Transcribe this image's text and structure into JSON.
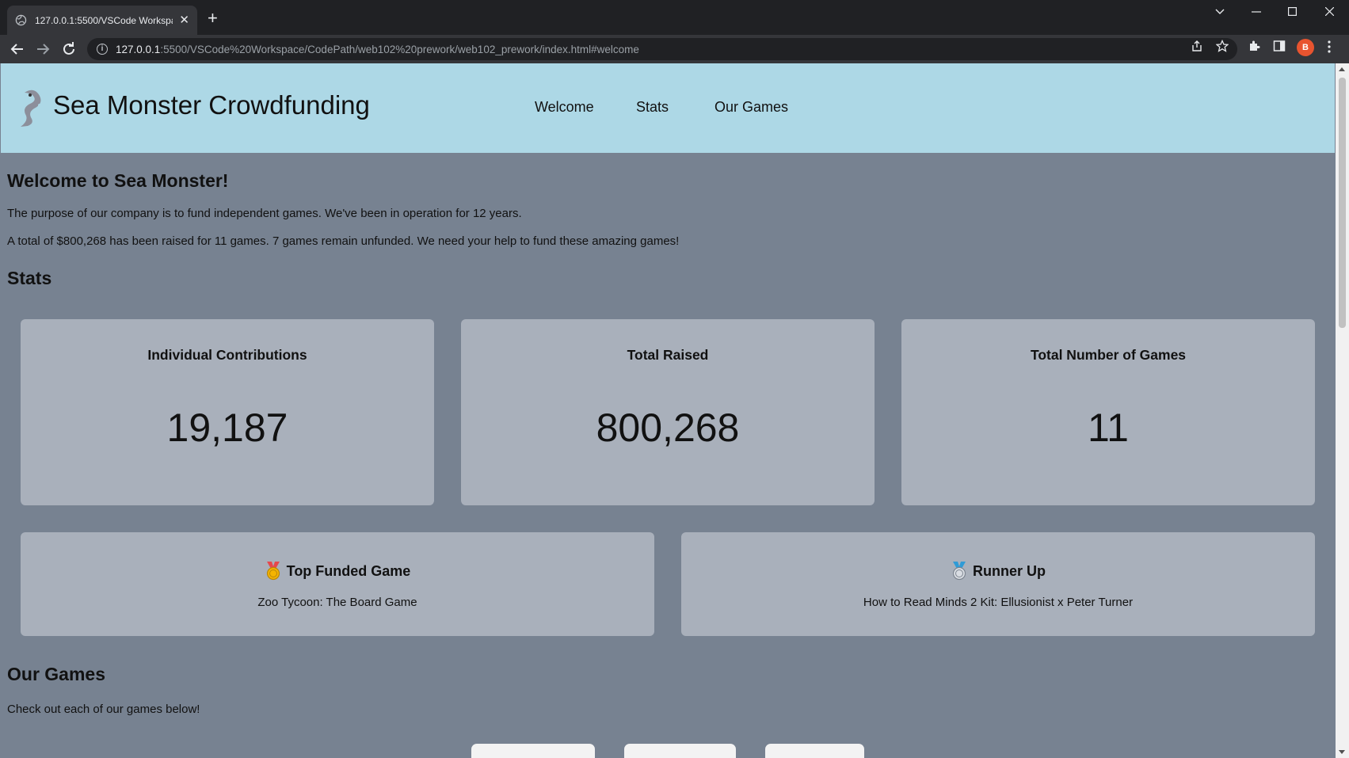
{
  "browser": {
    "tab_title": "127.0.0.1:5500/VSCode Workspac",
    "url_host": "127.0.0.1",
    "url_path": ":5500/VSCode%20Workspace/CodePath/web102%20prework/web102_prework/index.html#welcome",
    "profile_initial": "B",
    "new_tab_glyph": "+",
    "close_glyph": "✕"
  },
  "header": {
    "title": "Sea Monster Crowdfunding",
    "nav": [
      "Welcome",
      "Stats",
      "Our Games"
    ]
  },
  "welcome": {
    "heading": "Welcome to Sea Monster!",
    "intro": "The purpose of our company is to fund independent games. We've been in operation for 12 years.",
    "summary": "A total of $800,268 has been raised for 11 games. 7 games remain unfunded. We need your help to fund these amazing games!"
  },
  "stats": {
    "heading": "Stats",
    "cards": [
      {
        "label": "Individual Contributions",
        "value": "19,187"
      },
      {
        "label": "Total Raised",
        "value": "800,268"
      },
      {
        "label": "Total Number of Games",
        "value": "11"
      }
    ],
    "top_funded": {
      "label": "Top Funded Game",
      "name": "Zoo Tycoon: The Board Game",
      "icon": "gold-medal-icon"
    },
    "runner_up": {
      "label": "Runner Up",
      "name": "How to Read Minds 2 Kit: Ellusionist x Peter Turner",
      "icon": "silver-medal-icon"
    }
  },
  "games": {
    "heading": "Our Games",
    "intro": "Check out each of our games below!"
  },
  "colors": {
    "header_bg": "#add8e6",
    "page_bg": "#778291",
    "card_bg": "#a9b0bb"
  }
}
